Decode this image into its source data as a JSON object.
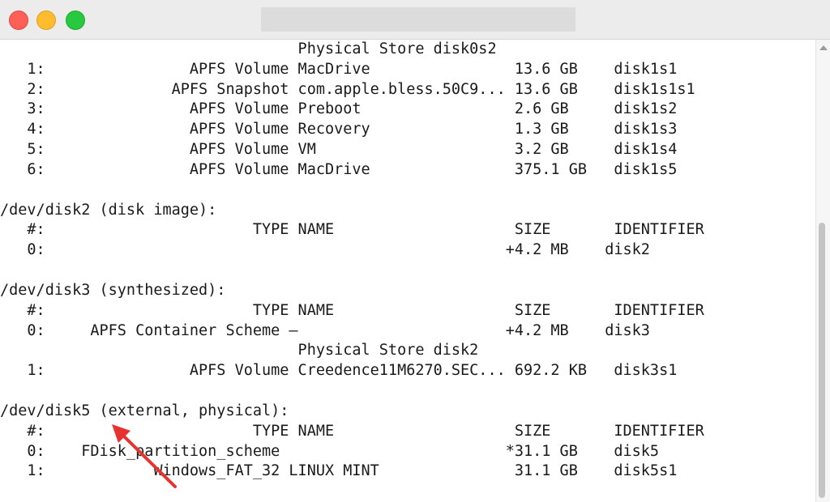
{
  "terminal": {
    "lines": [
      "                                 Physical Store disk0s2",
      "   1:                APFS Volume MacDrive                13.6 GB    disk1s1",
      "   2:              APFS Snapshot com.apple.bless.50C9... 13.6 GB    disk1s1s1",
      "   3:                APFS Volume Preboot                 2.6 GB     disk1s2",
      "   4:                APFS Volume Recovery                1.3 GB     disk1s3",
      "   5:                APFS Volume VM                      3.2 GB     disk1s4",
      "   6:                APFS Volume MacDrive                375.1 GB   disk1s5",
      "",
      "/dev/disk2 (disk image):",
      "   #:                       TYPE NAME                    SIZE       IDENTIFIER",
      "   0:                                                   +4.2 MB    disk2",
      "",
      "/dev/disk3 (synthesized):",
      "   #:                       TYPE NAME                    SIZE       IDENTIFIER",
      "   0:     APFS Container Scheme –                       +4.2 MB    disk3",
      "                                 Physical Store disk2",
      "   1:                APFS Volume Creedence11M6270.SEC... 692.2 KB   disk3s1",
      "",
      "/dev/disk5 (external, physical):",
      "   #:                       TYPE NAME                    SIZE       IDENTIFIER",
      "   0:    FDisk_partition_scheme                         *31.1 GB    disk5",
      "   1:            Windows_FAT_32 LINUX MINT               31.1 GB    disk5s1"
    ]
  },
  "colors": {
    "annotation_arrow": "#e8322f"
  },
  "icons": {
    "scroll_up": "triangle-up"
  }
}
